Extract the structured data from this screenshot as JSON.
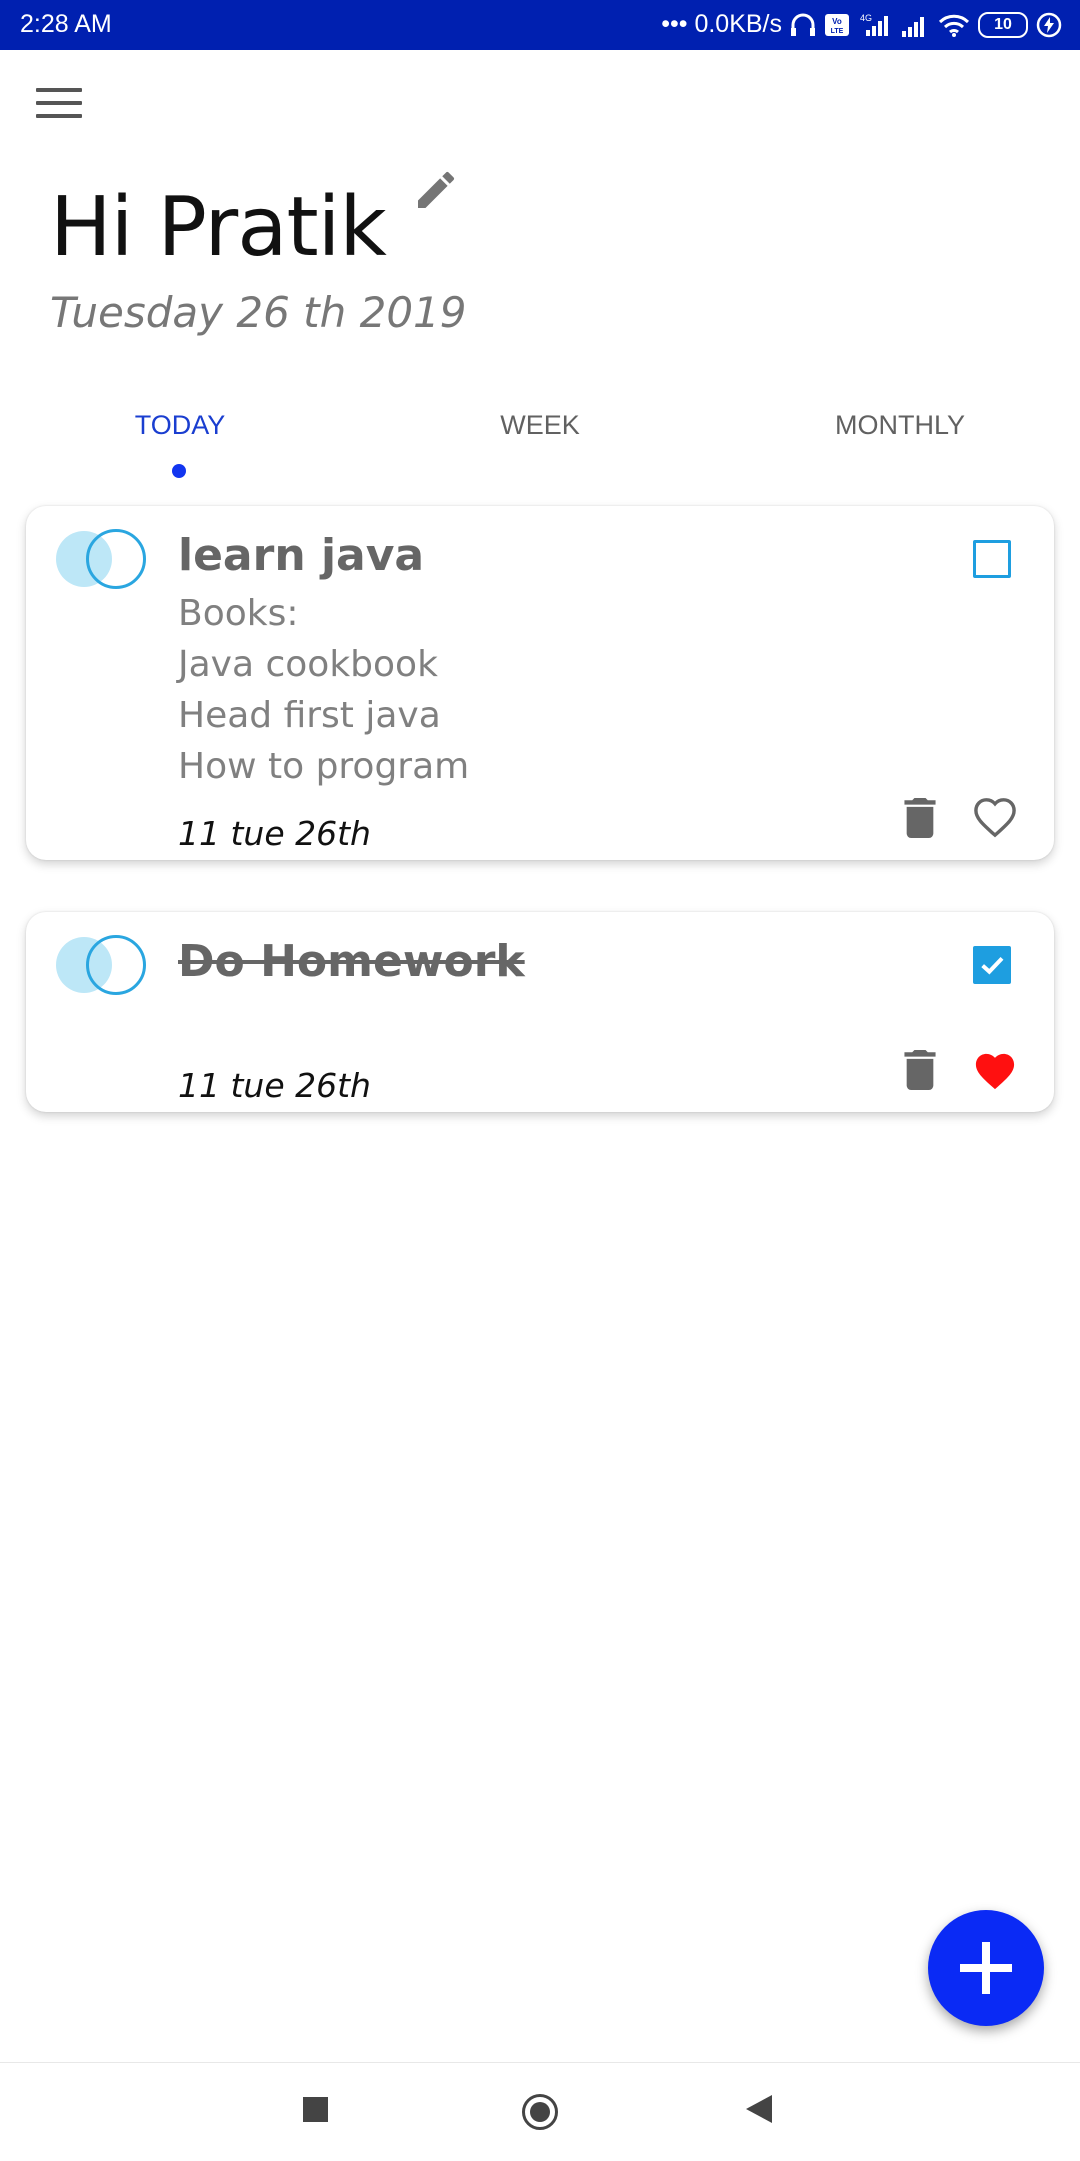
{
  "status_bar": {
    "time": "2:28 AM",
    "net_speed": "••• 0.0KB/s",
    "network_type": "4G",
    "battery": "10"
  },
  "header": {
    "greeting": "Hi Pratik",
    "date": "Tuesday 26 th 2019"
  },
  "tabs": [
    {
      "label": "TODAY",
      "active": true
    },
    {
      "label": "WEEK",
      "active": false
    },
    {
      "label": "MONTHLY",
      "active": false
    }
  ],
  "tasks": [
    {
      "title": "learn java",
      "description": [
        "Books:",
        "Java cookbook",
        "Head first java",
        "How to program"
      ],
      "time": "11 tue 26th",
      "completed": false,
      "favorite": false
    },
    {
      "title": "Do Homework",
      "description": [],
      "time": "11 tue 26th",
      "completed": true,
      "favorite": true
    }
  ],
  "colors": {
    "status_bar": "#0020b0",
    "accent": "#1235f0",
    "checkbox": "#1e9ee0",
    "heart_favorite": "#ff1010"
  },
  "icons": [
    "menu-icon",
    "edit-icon",
    "trash-icon",
    "heart-icon",
    "add-icon"
  ]
}
